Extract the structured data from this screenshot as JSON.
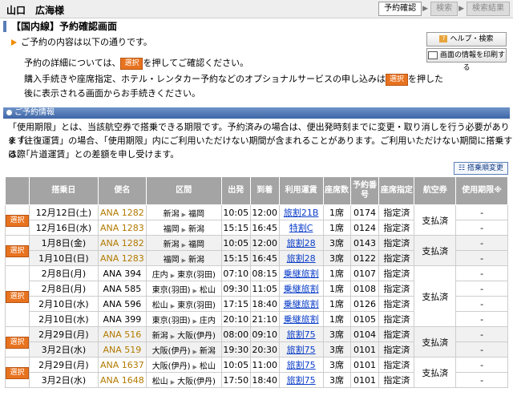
{
  "header": {
    "user_name": "山口　広海様",
    "steps": [
      "予約確認",
      "検索",
      "検索結果"
    ]
  },
  "page_title": "【国内線】予約確認画面",
  "notice": "ご予約の内容は以下の通りです。",
  "buttons": {
    "help": "ヘルプ・検索",
    "print": "画面の情報を印刷する",
    "select": "選択",
    "sort_change": "搭乗順変更"
  },
  "instructions": {
    "line1_pre": "予約の詳細については、",
    "line1_post": "を押してご確認ください。",
    "line2_pre": "購入手続きや座席指定、ホテル・レンタカー予約などのオプショナルサービスの申し込みは",
    "line2_post": "を押した",
    "line3": "後に表示される画面からお手続きください。"
  },
  "section_title": "ご予約情報",
  "info": {
    "line1": "「使用期限」とは、当該航空券で搭乗できる期限です。予約済みの場合は、便出発時刻までに変更・取り消しを行う必要があります。",
    "line2": "※「往復運賃」の場合、「使用期限」内にご利用いただけない期間が含まれることがあります。ご利用いただけない期間に搭乗する際",
    "line3": "は、「片道運賃」との差額を申し受けます。"
  },
  "table": {
    "headers": [
      "搭乗日",
      "便名",
      "区間",
      "出発",
      "到着",
      "利用運賃",
      "座席数",
      "予約番号",
      "座席指定",
      "航空券",
      "使用期限※"
    ],
    "groups": [
      {
        "ticket": "支払済",
        "rows": [
          {
            "date": "12月12日(土)",
            "flight": "ANA 1282",
            "from": "新潟",
            "to": "福岡",
            "dep": "10:05",
            "arr": "12:00",
            "fare": "旅割21B",
            "seats": "1席",
            "num": "0174",
            "seat_assign": "指定済",
            "expiry": "-"
          },
          {
            "date": "12月16日(水)",
            "flight": "ANA 1283",
            "from": "福岡",
            "to": "新潟",
            "dep": "15:15",
            "arr": "16:45",
            "fare": "特割C",
            "seats": "1席",
            "num": "0124",
            "seat_assign": "指定済",
            "expiry": "-"
          }
        ]
      },
      {
        "ticket": "支払済",
        "rows": [
          {
            "date": "1月8日(金)",
            "flight": "ANA 1282",
            "from": "新潟",
            "to": "福岡",
            "dep": "10:05",
            "arr": "12:00",
            "fare": "旅割28",
            "seats": "3席",
            "num": "0143",
            "seat_assign": "指定済",
            "expiry": "-"
          },
          {
            "date": "1月10日(日)",
            "flight": "ANA 1283",
            "from": "福岡",
            "to": "新潟",
            "dep": "15:15",
            "arr": "16:45",
            "fare": "旅割28",
            "seats": "3席",
            "num": "0122",
            "seat_assign": "指定済",
            "expiry": "-"
          }
        ]
      },
      {
        "ticket": "支払済",
        "rows": [
          {
            "date": "2月8日(月)",
            "flight": "ANA 394",
            "from": "庄内",
            "to": "東京(羽田)",
            "dep": "07:10",
            "arr": "08:15",
            "fare": "乗継旅割",
            "seats": "1席",
            "num": "0107",
            "seat_assign": "指定済",
            "expiry": "-"
          },
          {
            "date": "2月8日(月)",
            "flight": "ANA 585",
            "from": "東京(羽田)",
            "to": "松山",
            "dep": "09:30",
            "arr": "11:05",
            "fare": "乗継旅割",
            "seats": "1席",
            "num": "0108",
            "seat_assign": "指定済",
            "expiry": "-"
          },
          {
            "date": "2月10日(水)",
            "flight": "ANA 596",
            "from": "松山",
            "to": "東京(羽田)",
            "dep": "17:15",
            "arr": "18:40",
            "fare": "乗継旅割",
            "seats": "1席",
            "num": "0126",
            "seat_assign": "指定済",
            "expiry": "-"
          },
          {
            "date": "2月10日(水)",
            "flight": "ANA 399",
            "from": "東京(羽田)",
            "to": "庄内",
            "dep": "20:10",
            "arr": "21:10",
            "fare": "乗継旅割",
            "seats": "1席",
            "num": "0105",
            "seat_assign": "指定済",
            "expiry": "-"
          }
        ]
      },
      {
        "ticket": "支払済",
        "rows": [
          {
            "date": "2月29日(月)",
            "flight": "ANA 516",
            "from": "新潟",
            "to": "大阪(伊丹)",
            "dep": "08:00",
            "arr": "09:10",
            "fare": "旅割75",
            "seats": "3席",
            "num": "0104",
            "seat_assign": "指定済",
            "expiry": "-"
          },
          {
            "date": "3月2日(水)",
            "flight": "ANA 519",
            "from": "大阪(伊丹)",
            "to": "新潟",
            "dep": "19:30",
            "arr": "20:30",
            "fare": "旅割75",
            "seats": "3席",
            "num": "0101",
            "seat_assign": "指定済",
            "expiry": "-"
          }
        ]
      },
      {
        "ticket": "支払済",
        "rows": [
          {
            "date": "2月29日(月)",
            "flight": "ANA 1637",
            "from": "大阪(伊丹)",
            "to": "松山",
            "dep": "10:05",
            "arr": "11:00",
            "fare": "旅割75",
            "seats": "3席",
            "num": "0101",
            "seat_assign": "指定済",
            "expiry": "-"
          },
          {
            "date": "3月2日(水)",
            "flight": "ANA 1648",
            "from": "松山",
            "to": "大阪(伊丹)",
            "dep": "17:50",
            "arr": "18:40",
            "fare": "旅割75",
            "seats": "3席",
            "num": "0101",
            "seat_assign": "指定済",
            "expiry": "-"
          }
        ]
      }
    ]
  }
}
